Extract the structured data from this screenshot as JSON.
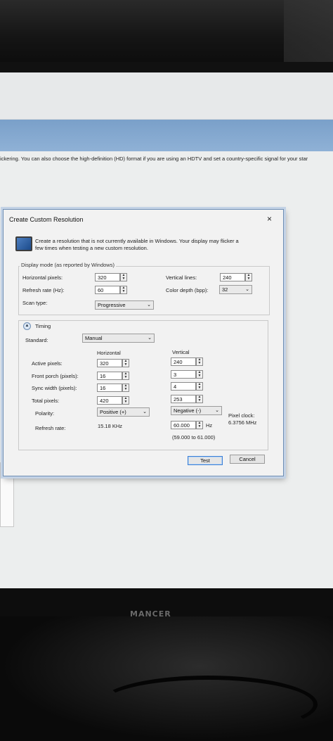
{
  "background": {
    "info_text": "ickering. You can also choose the high-definition (HD) format if you are using an HDTV and set a country-specific signal for your star",
    "monitor_brand": "MANCER"
  },
  "dialog": {
    "title": "Create Custom Resolution",
    "close": "×",
    "intro_line1": "Create a resolution that is not currently available in Windows. Your display may flicker a",
    "intro_line2": "few times when testing a new custom resolution.",
    "display_mode": {
      "group_label": "Display mode (as reported by Windows)",
      "horizontal_pixels_label": "Horizontal pixels:",
      "horizontal_pixels": "320",
      "vertical_lines_label": "Vertical lines:",
      "vertical_lines": "240",
      "refresh_rate_label": "Refresh rate (Hz):",
      "refresh_rate": "60",
      "color_depth_label": "Color depth (bpp):",
      "color_depth": "32",
      "scan_type_label": "Scan type:",
      "scan_type": "Progressive"
    },
    "timing": {
      "label": "Timing",
      "standard_label": "Standard:",
      "standard": "Manual",
      "horizontal_header": "Horizontal",
      "vertical_header": "Vertical",
      "active_pixels_label": "Active pixels:",
      "active_h": "320",
      "active_v": "240",
      "front_porch_label": "Front porch (pixels):",
      "front_porch_h": "16",
      "front_porch_v": "3",
      "sync_width_label": "Sync width (pixels):",
      "sync_width_h": "16",
      "sync_width_v": "4",
      "total_pixels_label": "Total pixels:",
      "total_h": "420",
      "total_v": "253",
      "polarity_label": "Polarity:",
      "polarity_h": "Positive (+)",
      "polarity_v": "Negative (-)",
      "pixel_clock_label": "Pixel clock:",
      "pixel_clock_value": "6.3756 MHz",
      "refresh_rate_label": "Refresh rate:",
      "refresh_h": "15.18 KHz",
      "refresh_v": "60.000",
      "refresh_v_unit": "Hz",
      "refresh_range": "(59.000 to 61.000)"
    },
    "test_button": "Test",
    "cancel_button": "Cancel"
  }
}
